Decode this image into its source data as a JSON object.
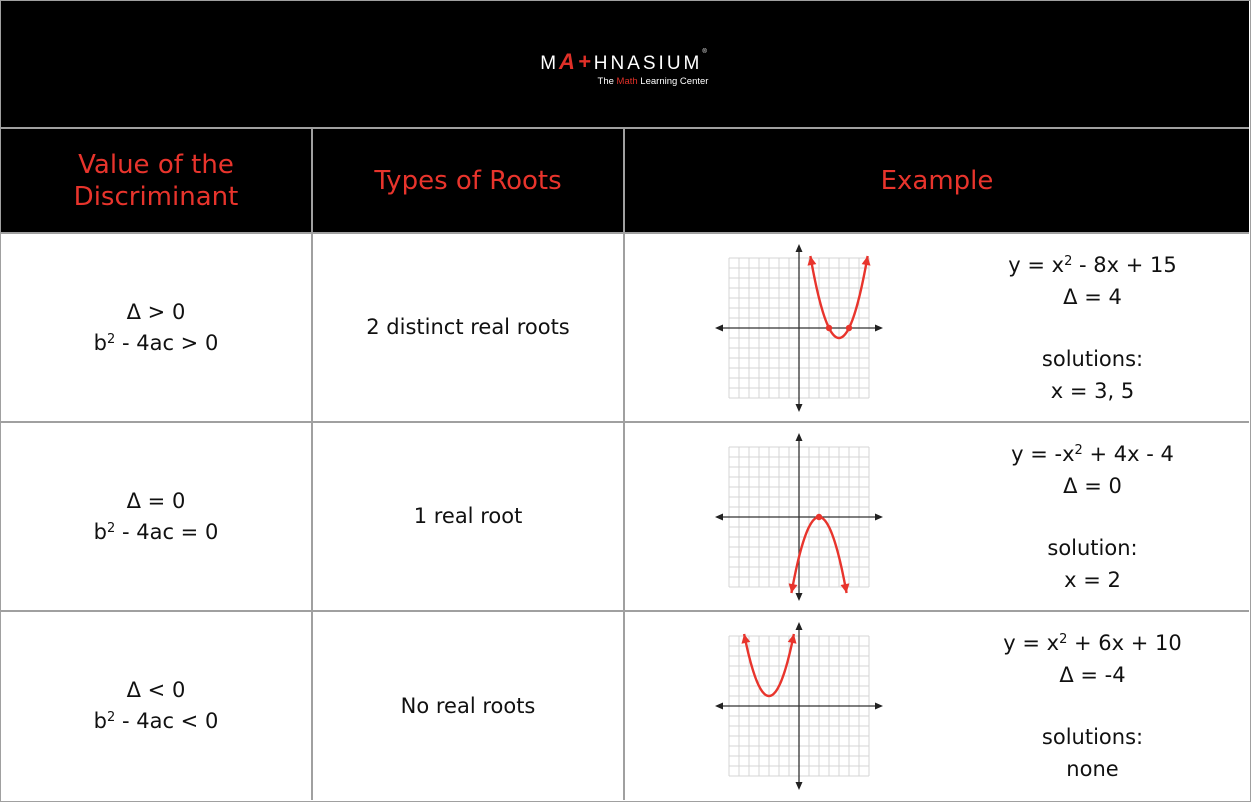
{
  "logo": {
    "brand_prefix": "M",
    "brand_mark": "A+",
    "brand_suffix": "HNASIUM",
    "trademark": "®",
    "tagline_pre": "The ",
    "tagline_accent": "Math",
    "tagline_post": " Learning Center"
  },
  "colors": {
    "accent": "#e8342c",
    "header_bg": "#000000",
    "border": "#a0a0a0",
    "curve": "#e8342c"
  },
  "header": {
    "col1_line1": "Value of the",
    "col1_line2": "Discriminant",
    "col2": "Types of Roots",
    "col3": "Example"
  },
  "rows": [
    {
      "delta": "Δ > 0",
      "disc_pre": "b",
      "disc_post": " - 4ac > 0",
      "roots": "2 distinct real roots",
      "eq_pre": "y = x",
      "eq_post": " - 8x + 15",
      "delta_value": "Δ = 4",
      "sol_label": "solutions:",
      "sol_value": "x = 3, 5",
      "graph": {
        "a": 1,
        "b": -8,
        "c": 15,
        "points": [
          3,
          5
        ]
      }
    },
    {
      "delta": "Δ = 0",
      "disc_pre": "b",
      "disc_post": " - 4ac = 0",
      "roots": "1 real root",
      "eq_pre": "y = -x",
      "eq_post": " + 4x - 4",
      "delta_value": "Δ = 0",
      "sol_label": "solution:",
      "sol_value": "x = 2",
      "graph": {
        "a": -1,
        "b": 4,
        "c": -4,
        "points": [
          2
        ]
      }
    },
    {
      "delta": "Δ < 0",
      "disc_pre": "b",
      "disc_post": " - 4ac < 0",
      "roots": "No real roots",
      "eq_pre": "y = x",
      "eq_post": " + 6x + 10",
      "delta_value": "Δ = -4",
      "sol_label": "solutions:",
      "sol_value": "none",
      "graph": {
        "a": 1,
        "b": 6,
        "c": 10,
        "points": []
      }
    }
  ],
  "superscript": "2",
  "graph_axes": {
    "xlim": [
      -7,
      7
    ],
    "ylim": [
      -7,
      7
    ]
  }
}
